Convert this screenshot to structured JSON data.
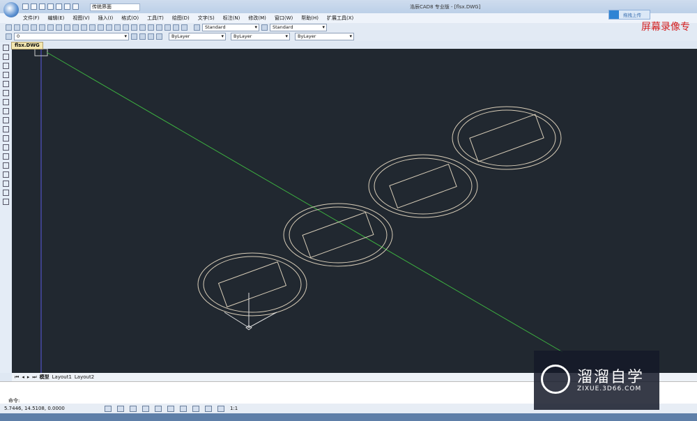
{
  "app": {
    "title": "浩辰CAD8 专业版 - [flsx.DWG]",
    "workspace": "传统界面"
  },
  "menu": [
    "文件(F)",
    "编辑(E)",
    "视图(V)",
    "插入(I)",
    "格式(O)",
    "工具(T)",
    "绘图(D)",
    "文字(S)",
    "标注(N)",
    "修改(M)",
    "窗口(W)",
    "帮助(H)",
    "扩展工具(X)"
  ],
  "upload_label": "拖拽上传",
  "overlay_text": "屏幕录像专",
  "styles": {
    "text_style": "Standard",
    "dim_style": "Standard"
  },
  "layer": {
    "name": "0",
    "color": "ByLayer",
    "linetype": "ByLayer",
    "lineweight": "ByLayer"
  },
  "document_tab": "flsx.DWG",
  "layout_tabs": [
    "模型",
    "Layout1",
    "Layout2"
  ],
  "command_prompt": "命令:",
  "status": {
    "coords": "5.7446, 14.5108, 0.0000",
    "scale": "1:1"
  },
  "watermark": {
    "cn": "溜溜自学",
    "en": "ZIXUE.3D66.COM"
  }
}
